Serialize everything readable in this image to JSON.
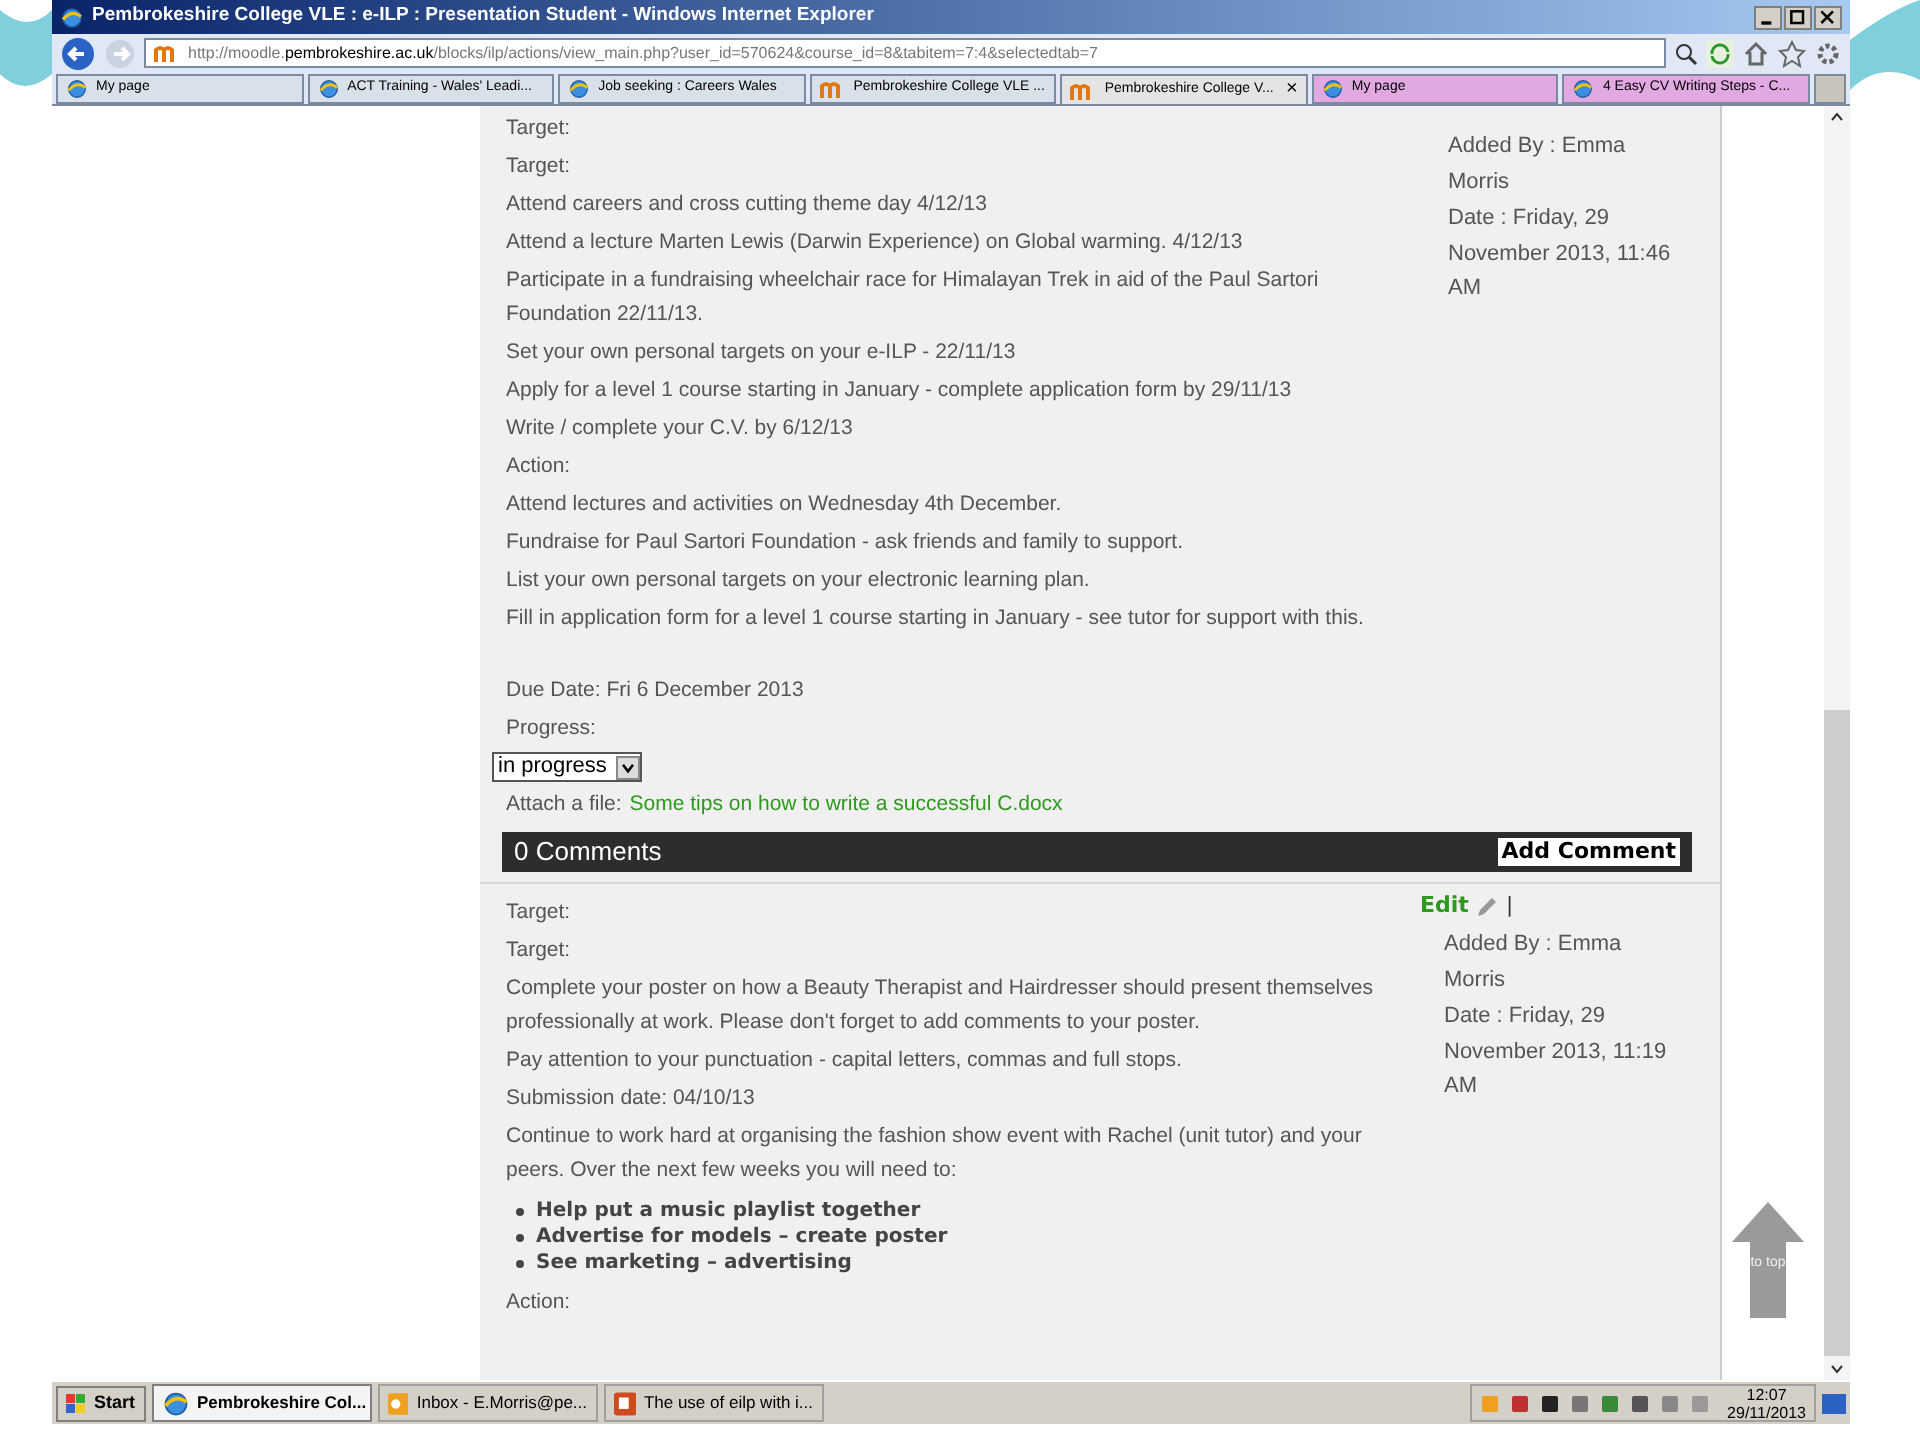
{
  "window": {
    "title": "Pembrokeshire College VLE : e-ILP : Presentation Student - Windows Internet Explorer"
  },
  "address_bar": {
    "url_prefix": "http://moodle.",
    "url_domain": "pembrokeshire.ac.uk",
    "url_rest": "/blocks/ilp/actions/view_main.php?user_id=570624&course_id=8&tabitem=7:4&selectedtab=7"
  },
  "tabs": [
    {
      "label": "My page",
      "selected": false,
      "color": "#d8e0ea"
    },
    {
      "label": "ACT Training - Wales' Leadi...",
      "selected": false,
      "color": "#d8e0ea"
    },
    {
      "label": "Job seeking : Careers Wales",
      "selected": false,
      "color": "#d8e0ea"
    },
    {
      "label": "Pembrokeshire College VLE ...",
      "selected": false,
      "color": "#d8e0ea"
    },
    {
      "label": "Pembrokeshire College V...",
      "selected": true,
      "color": "#e4e4e4",
      "close": "×"
    },
    {
      "label": "My page",
      "selected": false,
      "color": "#e2a8e2"
    },
    {
      "label": "4 Easy CV Writing Steps - C...",
      "selected": false,
      "color": "#e2a8e2"
    }
  ],
  "entries": [
    {
      "items": [
        {
          "kind": "text",
          "text": "Target:"
        },
        {
          "kind": "text",
          "text": "Target:"
        },
        {
          "kind": "text",
          "text": "Attend careers and cross cutting theme day 4/12/13"
        },
        {
          "kind": "text",
          "text": "Attend a lecture Marten Lewis (Darwin Experience) on Global warming. 4/12/13"
        },
        {
          "kind": "text",
          "text": "Participate in a fundraising wheelchair race for Himalayan Trek in aid of the Paul Sartori Foundation 22/11/13."
        },
        {
          "kind": "text",
          "text": "Set your own personal targets on your e-ILP - 22/11/13"
        },
        {
          "kind": "text",
          "text": "Apply for a level 1 course starting in January - complete application form by 29/11/13"
        },
        {
          "kind": "text",
          "text": "Write / complete your C.V. by 6/12/13"
        },
        {
          "kind": "text",
          "text": "Action:"
        },
        {
          "kind": "text",
          "text": "Attend lectures and activities on Wednesday 4th December."
        },
        {
          "kind": "text",
          "text": "Fundraise for Paul Sartori Foundation - ask friends and family to support."
        },
        {
          "kind": "text",
          "text": "List your own personal targets on your electronic learning plan."
        },
        {
          "kind": "text",
          "text": "Fill in application form for a level 1 course starting in January - see tutor for support with this."
        },
        {
          "kind": "gap"
        },
        {
          "kind": "text",
          "text": "Due Date: Fri 6 December 2013"
        },
        {
          "kind": "text",
          "text": "Progress:"
        },
        {
          "kind": "select",
          "value": "in progress"
        },
        {
          "kind": "attach",
          "label": "Attach a file:",
          "link": "Some tips on how to write a successful C.docx"
        },
        {
          "kind": "comments",
          "count": "0 Comments",
          "button": "Add Comment"
        }
      ],
      "added_by": "Added By : Emma Morris",
      "date": "Date : Friday, 29 November 2013, 11:46 AM"
    },
    {
      "edit": "Edit",
      "separator": "|",
      "items": [
        {
          "kind": "text",
          "text": "Target:"
        },
        {
          "kind": "text",
          "text": "Target:"
        },
        {
          "kind": "text",
          "text": "Complete your poster on how a Beauty Therapist and Hairdresser should present themselves professionally at work. Please don't forget to add comments to your poster."
        },
        {
          "kind": "text",
          "text": "Pay attention to your punctuation - capital letters, commas and full stops."
        },
        {
          "kind": "text",
          "text": "Submission date: 04/10/13"
        },
        {
          "kind": "text",
          "text": "Continue to work hard at organising the fashion show event with Rachel (unit tutor) and your peers. Over the next few weeks you will need to:"
        },
        {
          "kind": "bullets",
          "items": [
            "Help put a music playlist together",
            "Advertise for models – create poster",
            "See marketing – advertising"
          ]
        },
        {
          "kind": "text",
          "text": "Action:"
        }
      ],
      "added_by": "Added By : Emma Morris",
      "date": "Date : Friday, 29 November 2013, 11:19 AM"
    }
  ],
  "to_top": "to top",
  "taskbar": {
    "start": "Start",
    "buttons": [
      {
        "label": "Pembrokeshire Col...",
        "selected": true,
        "kind": "ie"
      },
      {
        "label": "Inbox - E.Morris@pe...",
        "selected": false,
        "kind": "outlook"
      },
      {
        "label": "The use of eilp with i...",
        "selected": false,
        "kind": "ppt"
      }
    ],
    "time": "12:07",
    "date": "29/11/2013"
  }
}
